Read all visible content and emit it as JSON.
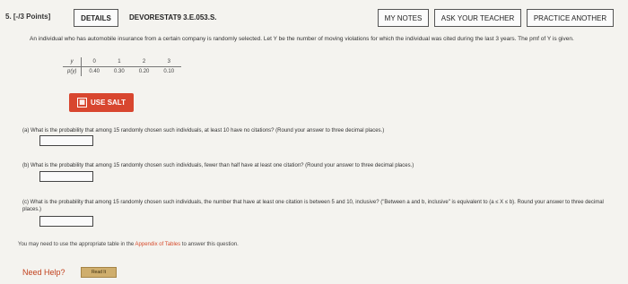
{
  "header": {
    "question_number": "5. [-/3 Points]",
    "details_label": "DETAILS",
    "question_id": "DEVORESTAT9 3.E.053.S.",
    "my_notes_label": "MY NOTES",
    "ask_teacher_label": "ASK YOUR TEACHER",
    "practice_label": "PRACTICE ANOTHER"
  },
  "problem": {
    "intro": "An individual who has automobile insurance from a certain company is randomly selected. Let Y be the number of moving violations for which the individual was cited during the last 3 years. The pmf of Y is given.",
    "pmf": {
      "y_label": "y",
      "p_label": "p(y)",
      "y_values": [
        "0",
        "1",
        "2",
        "3"
      ],
      "p_values": [
        "0.40",
        "0.30",
        "0.20",
        "0.10"
      ]
    },
    "use_salt_label": "USE SALT",
    "parts": {
      "a": "(a)  What is the probability that among 15 randomly chosen such individuals, at least 10 have no citations? (Round your answer to three decimal places.)",
      "b": "(b)  What is the probability that among 15 randomly chosen such individuals, fewer than half have at least one citation? (Round your answer to three decimal places.)",
      "c": "(c)  What is the probability that among 15 randomly chosen such individuals, the number that have at least one citation is between 5 and 10, inclusive? (\"Between a and b, inclusive\" is equivalent to (a ≤ X ≤ b). Round your answer to three decimal places.)"
    },
    "table_note_prefix": "You may need to use the appropriate table in the ",
    "table_note_link": "Appendix of Tables",
    "table_note_suffix": " to answer this question."
  },
  "help": {
    "need_help_label": "Need Help?",
    "read_it_label": "Read It"
  },
  "colors": {
    "salt_button": "#d8462f",
    "need_help": "#c2421e",
    "read_it": "#cfae6d"
  }
}
